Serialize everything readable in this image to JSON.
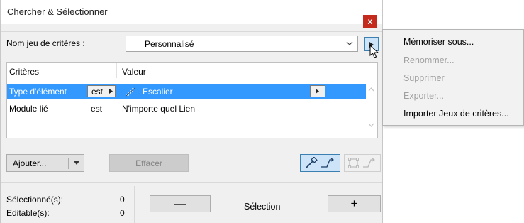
{
  "window": {
    "title": "Chercher & Sélectionner",
    "close_glyph": "x"
  },
  "criteria_set": {
    "label": "Nom jeu de critères :",
    "value": "Personnalisé"
  },
  "table": {
    "headers": {
      "criteria": "Critères",
      "value": "Valeur"
    },
    "rows": [
      {
        "criterion": "Type d'élément",
        "operator": "est",
        "value": "Escalier",
        "selected": true
      },
      {
        "criterion": "Module lié",
        "operator": "est",
        "value": "N'importe quel Lien",
        "selected": false
      }
    ]
  },
  "buttons": {
    "add": "Ajouter...",
    "clear": "Effacer",
    "minus": "—",
    "plus": "+"
  },
  "status": {
    "selected_label": "Sélectionné(s):",
    "selected_count": "0",
    "editable_label": "Editable(s):",
    "editable_count": "0",
    "selection_label": "Sélection"
  },
  "popup_menu": {
    "items": [
      {
        "label": "Mémoriser sous...",
        "enabled": true
      },
      {
        "label": "Renommer...",
        "enabled": false
      },
      {
        "label": "Supprimer",
        "enabled": false
      },
      {
        "label": "Exporter...",
        "enabled": false
      },
      {
        "label": "Importer Jeux de critères...",
        "enabled": true
      }
    ]
  },
  "colors": {
    "selection": "#3399ff",
    "close": "#c42b1c",
    "accent_border": "#3c7fb1"
  }
}
